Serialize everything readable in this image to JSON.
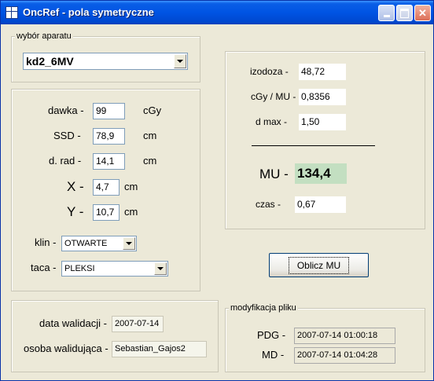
{
  "window": {
    "title": "OncRef - pola symetryczne"
  },
  "apparatus": {
    "caption": "wybór aparatu",
    "selected": "kd2_6MV"
  },
  "inputs": {
    "dose": {
      "label": "dawka -",
      "value": "99",
      "unit": "cGy"
    },
    "ssd": {
      "label": "SSD -",
      "value": "78,9",
      "unit": "cm"
    },
    "drad": {
      "label": "d. rad -",
      "value": "14,1",
      "unit": "cm"
    },
    "x": {
      "label": "X -",
      "value": "4,7",
      "unit": "cm"
    },
    "y": {
      "label": "Y -",
      "value": "10,7",
      "unit": "cm"
    },
    "klin": {
      "label": "klin -",
      "selected": "OTWARTE"
    },
    "taca": {
      "label": "taca -",
      "selected": "PLEKSI"
    }
  },
  "results": {
    "izodoza": {
      "label": "izodoza -",
      "value": "48,72"
    },
    "cgymu": {
      "label": "cGy / MU -",
      "value": "0,8356"
    },
    "dmax": {
      "label": "d max -",
      "value": "1,50"
    },
    "mu": {
      "label": "MU -",
      "value": "134,4"
    },
    "czas": {
      "label": "czas -",
      "value": "0,67"
    }
  },
  "calc_button": "Oblicz MU",
  "validation": {
    "date_label": "data walidacji -",
    "date_value": "2007-07-14",
    "person_label": "osoba walidująca -",
    "person_value": "Sebastian_Gajos2"
  },
  "file_mod": {
    "caption": "modyfikacja pliku",
    "pdg_label": "PDG -",
    "pdg_value": "2007-07-14 01:00:18",
    "md_label": "MD -",
    "md_value": "2007-07-14 01:04:28"
  }
}
